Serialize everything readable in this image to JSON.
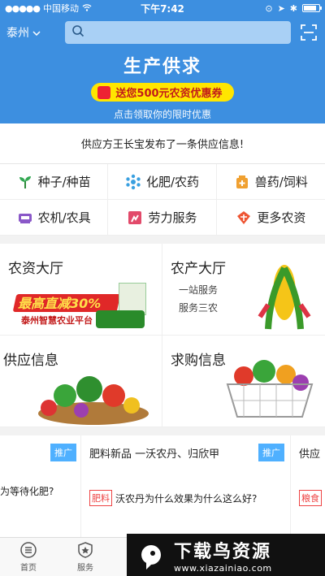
{
  "status_bar": {
    "carrier": "中国移动",
    "time": "下午7:42"
  },
  "topbar": {
    "city": "泰州"
  },
  "hero": {
    "title": "生产供求",
    "coupon": "送您500元农资优惠券",
    "subtitle": "点击领取你的限时优惠"
  },
  "notice": "供应方王长宝发布了一条供应信息!",
  "categories": [
    {
      "label": "种子/种苗",
      "icon": "seedling-icon"
    },
    {
      "label": "化肥/农药",
      "icon": "snowflake-icon"
    },
    {
      "label": "兽药/饲料",
      "icon": "medicine-icon"
    },
    {
      "label": "农机/农具",
      "icon": "machine-icon"
    },
    {
      "label": "劳力服务",
      "icon": "worker-icon"
    },
    {
      "label": "更多农资",
      "icon": "grid-icon"
    }
  ],
  "halls": {
    "agri_input": {
      "title": "农资大厅",
      "promo_big": "最高直减30%",
      "promo_small": "泰州智慧农业平台"
    },
    "agri_product": {
      "title": "农产大厅",
      "line1": "一站服务",
      "line2": "服务三农"
    },
    "supply": {
      "title": "供应信息"
    },
    "purchase": {
      "title": "求购信息"
    }
  },
  "ads": [
    {
      "tag": "推广",
      "title": "",
      "line": "为等待化肥?",
      "chip": ""
    },
    {
      "tag": "推广",
      "title": "肥料新品 一沃农丹、归欣甲",
      "line": "沃农丹为什么效果为什么这么好?",
      "chip": "肥料"
    },
    {
      "tag": "",
      "title": "供应",
      "line": "",
      "chip": "粮食"
    }
  ],
  "tabbar": [
    {
      "label": "首页",
      "icon": "home-icon"
    },
    {
      "label": "服务",
      "icon": "star-badge-icon"
    }
  ],
  "watermark": {
    "text": "下载鸟资源",
    "url": "www.xiazainiao.com"
  }
}
